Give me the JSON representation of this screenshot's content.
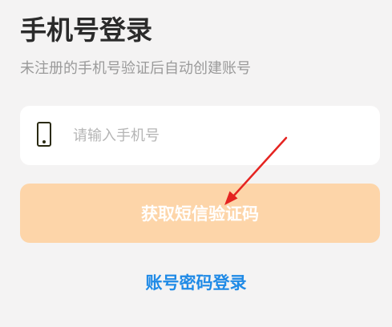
{
  "page": {
    "title": "手机号登录",
    "subtitle": "未注册的手机号验证后自动创建账号"
  },
  "phone_field": {
    "placeholder": "请输入手机号",
    "value": ""
  },
  "get_code_button": {
    "label": "获取短信验证码",
    "background": "#fdd5a9"
  },
  "password_login": {
    "label": "账号密码登录",
    "color": "#1f8ae6"
  },
  "icons": {
    "phone": "mobile-phone-icon"
  },
  "annotation": {
    "color": "#e52421"
  }
}
